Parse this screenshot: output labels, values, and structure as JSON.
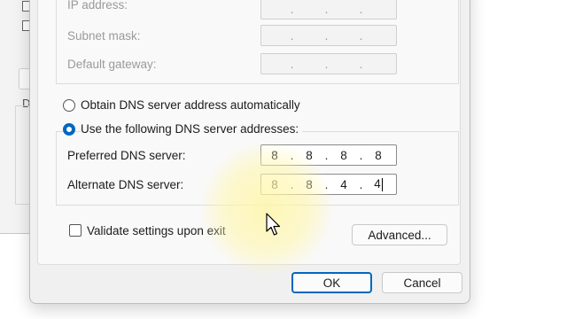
{
  "ip_section": {
    "ip_address_label": "IP address:",
    "subnet_mask_label": "Subnet mask:",
    "default_gateway_label": "Default gateway:",
    "dots": ".   .   ."
  },
  "dns_section": {
    "obtain_auto_label": "Obtain DNS server address automatically",
    "use_following_label": "Use the following DNS server addresses:",
    "selected_option": "use_following",
    "preferred_label": "Preferred DNS server:",
    "preferred_value": [
      "8",
      "8",
      "8",
      "8"
    ],
    "alternate_label": "Alternate DNS server:",
    "alternate_value": [
      "8",
      "8",
      "4",
      "4"
    ]
  },
  "validate_label": "Validate settings upon exit",
  "validate_checked": false,
  "advanced_label": "Advanced...",
  "ok_label": "OK",
  "cancel_label": "Cancel",
  "background_window": {
    "label_fragment": "D"
  },
  "colors": {
    "accent": "#0067c0",
    "highlight": "#fff6aa"
  },
  "icons": {
    "cursor": "arrow-cursor-icon"
  }
}
